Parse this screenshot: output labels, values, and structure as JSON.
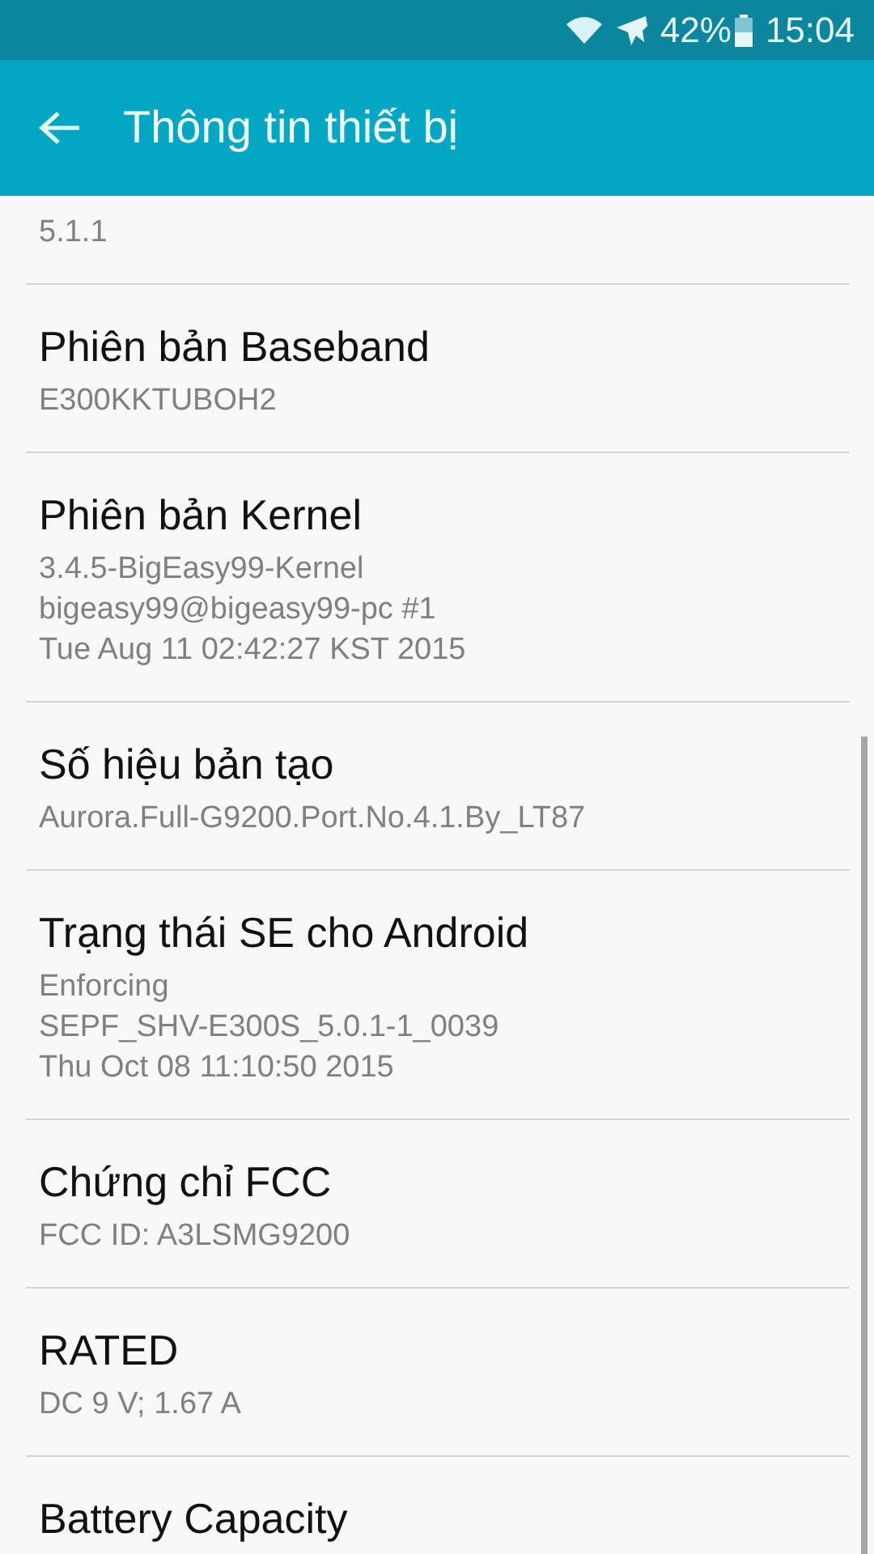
{
  "status_bar": {
    "battery": "42%",
    "time": "15:04"
  },
  "app_bar": {
    "title": "Thông tin thiết bị"
  },
  "items": [
    {
      "values": [
        "5.1.1"
      ]
    },
    {
      "title": "Phiên bản Baseband",
      "values": [
        "E300KKTUBOH2"
      ]
    },
    {
      "title": "Phiên bản Kernel",
      "values": [
        "3.4.5-BigEasy99-Kernel",
        "bigeasy99@bigeasy99-pc #1",
        "Tue Aug 11 02:42:27 KST 2015"
      ]
    },
    {
      "title": "Số hiệu bản tạo",
      "values": [
        "Aurora.Full-G9200.Port.No.4.1.By_LT87"
      ]
    },
    {
      "title": "Trạng thái SE cho Android",
      "values": [
        "Enforcing",
        "SEPF_SHV-E300S_5.0.1-1_0039",
        "Thu Oct 08 11:10:50 2015"
      ]
    },
    {
      "title": "Chứng chỉ FCC",
      "values": [
        "FCC ID: A3LSMG9200"
      ]
    },
    {
      "title": "RATED",
      "values": [
        "DC 9 V; 1.67 A"
      ]
    },
    {
      "title": "Battery Capacity"
    }
  ]
}
